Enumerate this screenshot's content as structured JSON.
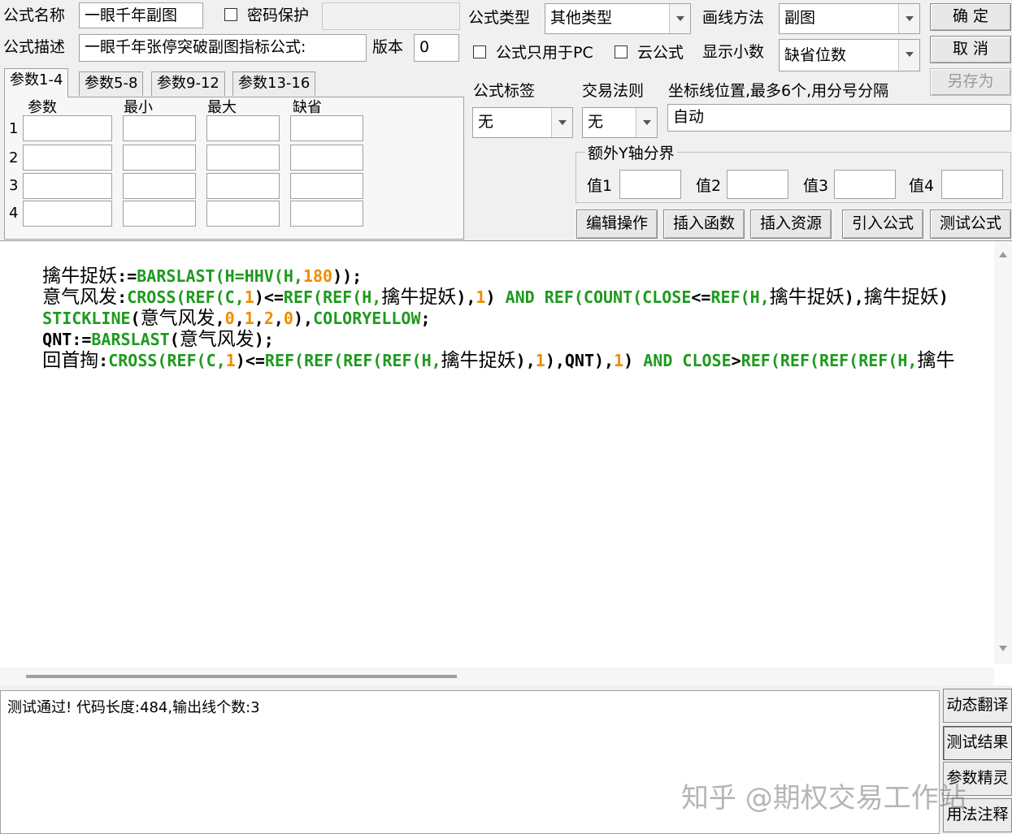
{
  "formula": {
    "name_label": "公式名称",
    "name_value": "一眼千年副图",
    "password_label": "密码保护",
    "desc_label": "公式描述",
    "desc_value": "一眼千年张停突破副图指标公式:",
    "version_label": "版本",
    "version_value": "0",
    "type_label": "公式类型",
    "type_value": "其他类型",
    "draw_label": "画线方法",
    "draw_value": "副图",
    "pc_only_label": "公式只用于PC",
    "cloud_label": "云公式",
    "decimal_label": "显示小数",
    "decimal_value": "缺省位数",
    "tag_label": "公式标签",
    "tag_value": "无",
    "trade_label": "交易法则",
    "trade_value": "无",
    "coord_label": "坐标线位置,最多6个,用分号分隔",
    "coord_value": "自动",
    "yaxis_group": "额外Y轴分界",
    "y_values": [
      "值1",
      "值2",
      "值3",
      "值4"
    ]
  },
  "buttons": {
    "ok": "确  定",
    "cancel": "取  消",
    "save_as": "另存为",
    "edit_ops": "编辑操作",
    "insert_func": "插入函数",
    "insert_res": "插入资源",
    "import_formula": "引入公式",
    "test_formula": "测试公式"
  },
  "tabs": [
    "参数1-4",
    "参数5-8",
    "参数9-12",
    "参数13-16"
  ],
  "param_headers": [
    "参数",
    "最小",
    "最大",
    "缺省"
  ],
  "param_rows": [
    "1",
    "2",
    "3",
    "4"
  ],
  "code": {
    "l1": {
      "a": "擒牛捉妖",
      "b": ":=",
      "c": "BARSLAST",
      "d": "(H=",
      "e": "HHV",
      "f": "(H,",
      "g": "180",
      "h": "));"
    },
    "l2": {
      "a": "意气风发",
      "b": ":",
      "c": "CROSS",
      "d": "(",
      "e": "REF",
      "f": "(C,",
      "g": "1",
      "h": ")<=",
      "i": "REF",
      "j": "(",
      "k": "REF",
      "l": "(H,",
      "m": "擒牛捉妖",
      "n": "),",
      "o": "1",
      "p": ") ",
      "q": "AND",
      "r": " ",
      "s": "REF",
      "t": "(",
      "u": "COUNT",
      "v": "(",
      "w": "CLOSE",
      "x": "<=",
      "y": "REF",
      "z": "(H,",
      "aa": "擒牛捉妖",
      "ab": "),",
      "ac": "擒牛捉妖",
      "ad": ")"
    },
    "l3": {
      "a": "STICKLINE",
      "b": "(",
      "c": "意气风发",
      "d": ",",
      "e": "0",
      "f": ",",
      "g": "1",
      "h": ",",
      "i": "2",
      "j": ",",
      "k": "0",
      "l": "),",
      "m": "COLORYELLOW",
      "n": ";"
    },
    "l4": {
      "a": "QNT",
      "b": ":=",
      "c": "BARSLAST",
      "d": "(",
      "e": "意气风发",
      "f": ");"
    },
    "l5": {
      "a": "回首掏",
      "b": ":",
      "c": "CROSS",
      "d": "(",
      "e": "REF",
      "f": "(C,",
      "g": "1",
      "h": ")<=",
      "i": "REF",
      "j": "(",
      "k": "REF",
      "l": "(",
      "m": "REF",
      "n": "(",
      "o": "REF",
      "p": "(H,",
      "q": "擒牛捉妖",
      "r": "),",
      "s": "1",
      "t": "),QNT),",
      "u": "1",
      "v": ") ",
      "w": "AND",
      "x": " ",
      "y": "CLOSE",
      "z": ">",
      "aa": "REF",
      "ab": "(",
      "ac": "REF",
      "ad": "(",
      "ae": "REF",
      "af": "(",
      "ag": "REF",
      "ah": "(H,",
      "ai": "擒牛"
    }
  },
  "status_text": "测试通过! 代码长度:484,输出线个数:3",
  "side_buttons": [
    "动态翻译",
    "测试结果",
    "参数精灵",
    "用法注释"
  ],
  "watermark": "知乎 @期权交易工作站",
  "colors": {
    "keyword": "#1e9a1e",
    "number": "#f08c00"
  }
}
